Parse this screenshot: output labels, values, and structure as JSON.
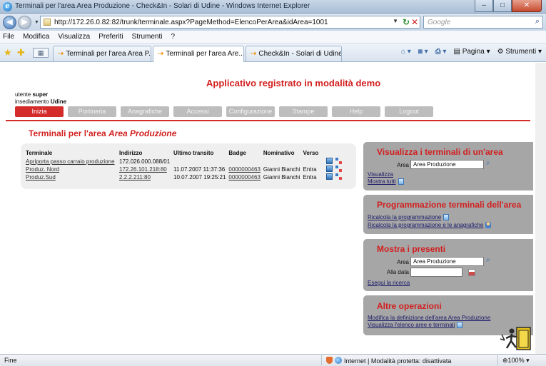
{
  "window": {
    "title": "Terminali per l'area Area Produzione - Check&In - Solari di Udine - Windows Internet Explorer",
    "logo_icon": "ie-logo-icon",
    "buttons": [
      "minimize-icon",
      "maximize-icon",
      "close-icon"
    ]
  },
  "browser": {
    "url": "http://172.26.0.82:82/trunk/terminale.aspx?PageMethod=ElencoPerArea&idArea=1001",
    "search_placeholder": "Google",
    "menu": [
      "File",
      "Modifica",
      "Visualizza",
      "Preferiti",
      "Strumenti",
      "?"
    ],
    "tabs": [
      {
        "label": "Terminali per l'area Area P...",
        "active": false
      },
      {
        "label": "Terminali per l'area Are...",
        "active": true
      },
      {
        "label": "Check&In - Solari di Udine",
        "active": false
      }
    ],
    "toolbar_right": {
      "page": "Pagina",
      "tools": "Strumenti"
    }
  },
  "page": {
    "demo_banner": "Applicativo registrato in modalità demo",
    "user_prefix": "utente",
    "user_name": "super",
    "site_prefix": "insediamento",
    "site_name": "Udine",
    "nav": [
      {
        "label": "Inizia",
        "active": true
      },
      {
        "label": "Portineria",
        "active": false
      },
      {
        "label": "Anagrafiche",
        "active": false
      },
      {
        "label": "Accessi",
        "active": false
      },
      {
        "label": "Configurazione",
        "active": false
      },
      {
        "label": "Stampe",
        "active": false
      },
      {
        "label": "Help",
        "active": false
      },
      {
        "label": "Logout",
        "active": false
      }
    ],
    "section_title_prefix": "Terminali per l'area",
    "section_title_area": "Area Produzione",
    "table": {
      "columns": [
        "Terminale",
        "Indirizzo",
        "Ultimo transito",
        "Badge",
        "Nominativo",
        "Verso"
      ],
      "rows": [
        {
          "terminale": "Apriporta passo carraio produzione",
          "indirizzo": "172.026.000.088/01",
          "ultimo": "",
          "badge": "",
          "nominativo": "",
          "verso": ""
        },
        {
          "terminale": "Produz. Nord",
          "indirizzo": "172.26.101.218:80",
          "ultimo": "11.07.2007 11:37:36",
          "badge": "0000000463",
          "nominativo": "Gianni Bianchi",
          "verso": "Entra"
        },
        {
          "terminale": "Produz.Sud",
          "indirizzo": "2.2.2.211:80",
          "ultimo": "10.07.2007 19:25:21",
          "badge": "0000000463",
          "nominativo": "Gianni Bianchi",
          "verso": "Entra"
        }
      ]
    },
    "panels": {
      "visualizza": {
        "title": "Visualizza i terminali di un'area",
        "area_label": "Area",
        "area_value": "Area Produzione",
        "link_view": "Visualizza",
        "link_all": "Mostra tutti"
      },
      "programmazione": {
        "title": "Programmazione terminali dell'area",
        "link_recalc": "Ricalcola la programmazione",
        "link_recalc_anag": "Ricalcola la programmazione e le anagrafiche"
      },
      "presenti": {
        "title": "Mostra i presenti",
        "area_label": "Area",
        "area_value": "Area Produzione",
        "date_label": "Alla data",
        "date_value": "",
        "link_search": "Esegui la ricerca"
      },
      "altre": {
        "title": "Altre operazioni",
        "link_modify": "Modifica la definizione dell'area Area Produzione",
        "link_list": "Visualizza l'elenco aree e terminali"
      }
    }
  },
  "statusbar": {
    "status": "Fine",
    "zone": "Internet | Modalità protetta: disattivata",
    "zoom": "100%"
  }
}
